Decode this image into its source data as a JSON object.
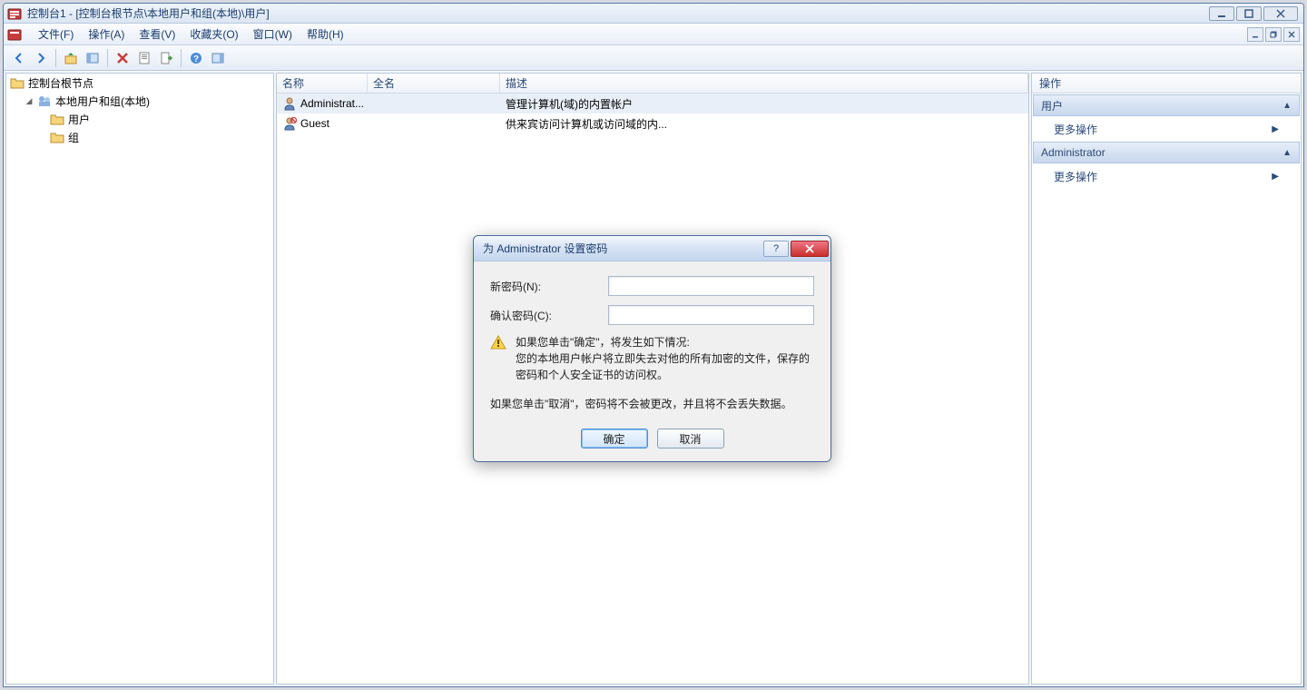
{
  "titlebar": {
    "title": "控制台1 - [控制台根节点\\本地用户和组(本地)\\用户]"
  },
  "menu": {
    "file": "文件(F)",
    "action": "操作(A)",
    "view": "查看(V)",
    "favorites": "收藏夹(O)",
    "window": "窗口(W)",
    "help": "帮助(H)"
  },
  "tree": {
    "root": "控制台根节点",
    "localUsers": "本地用户和组(本地)",
    "users": "用户",
    "groups": "组"
  },
  "list": {
    "cols": {
      "name": "名称",
      "fullname": "全名",
      "desc": "描述"
    },
    "rows": [
      {
        "name": "Administrat...",
        "fullname": "",
        "desc": "管理计算机(域)的内置帐户"
      },
      {
        "name": "Guest",
        "fullname": "",
        "desc": "供来宾访问计算机或访问域的内..."
      }
    ]
  },
  "actions": {
    "header": "操作",
    "section1": "用户",
    "more1": "更多操作",
    "section2": "Administrator",
    "more2": "更多操作"
  },
  "dialog": {
    "title": "为 Administrator 设置密码",
    "newPwd": "新密码(N):",
    "confirmPwd": "确认密码(C):",
    "warn1": "如果您单击\"确定\"，将发生如下情况:",
    "warn2": "您的本地用户帐户将立即失去对他的所有加密的文件，保存的密码和个人安全证书的访问权。",
    "info": "如果您单击\"取消\"，密码将不会被更改，并且将不会丢失数据。",
    "ok": "确定",
    "cancel": "取消"
  }
}
